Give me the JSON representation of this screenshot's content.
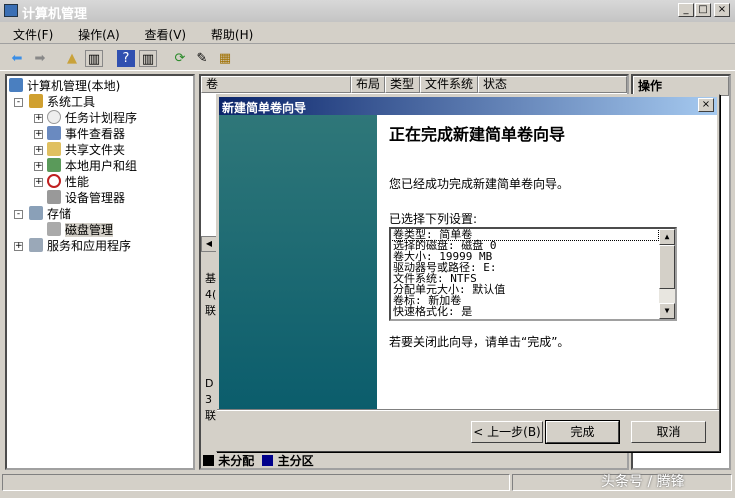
{
  "window": {
    "title": "计算机管理",
    "min": "_",
    "max": "□",
    "close": "×"
  },
  "menu": [
    "文件(F)",
    "操作(A)",
    "查看(V)",
    "帮助(H)"
  ],
  "tree": {
    "root": "计算机管理(本地)",
    "system_tools": "系统工具",
    "task_scheduler": "任务计划程序",
    "event_viewer": "事件查看器",
    "shared_folders": "共享文件夹",
    "local_users": "本地用户和组",
    "performance": "性能",
    "device_manager": "设备管理器",
    "storage": "存储",
    "disk_management": "磁盘管理",
    "services_apps": "服务和应用程序"
  },
  "columns": [
    "卷",
    "布局",
    "类型",
    "文件系统",
    "状态"
  ],
  "actions_header": "操作",
  "disk_labels": [
    "基",
    "4(",
    "联",
    "D",
    "3",
    "联"
  ],
  "legend": [
    "未分配",
    "主分区"
  ],
  "colors": {
    "unallocated": "#000000",
    "primary": "#00008b"
  },
  "dialog": {
    "title": "新建简单卷向导",
    "close": "×",
    "heading": "正在完成新建简单卷向导",
    "completed": "您已经成功完成新建简单卷向导。",
    "selected_label": "已选择下列设置:",
    "settings": [
      "卷类型: 简单卷",
      "选择的磁盘: 磁盘 0",
      "卷大小: 19999 MB",
      "驱动器号或路径: E:",
      "文件系统: NTFS",
      "分配单元大小: 默认值",
      "卷标: 新加卷",
      "快速格式化: 是"
    ],
    "close_hint": "若要关闭此向导，请单击“完成”。",
    "back": "< 上一步(B)",
    "finish": "完成",
    "cancel": "取消"
  },
  "watermark": "头条号 / 腾锋"
}
